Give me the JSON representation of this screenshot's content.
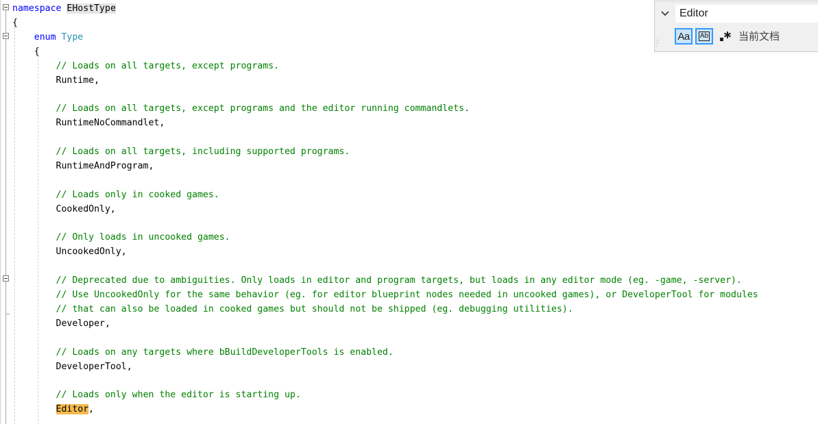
{
  "code": {
    "lines": [
      [
        {
          "t": "namespace",
          "c": "kw"
        },
        {
          "t": " ",
          "c": "id"
        },
        {
          "t": "EHostType",
          "c": "id",
          "h": "sel"
        }
      ],
      [
        {
          "t": "{",
          "c": "id"
        }
      ],
      [
        {
          "t": "    ",
          "c": "id"
        },
        {
          "t": "enum",
          "c": "kw"
        },
        {
          "t": " ",
          "c": "id"
        },
        {
          "t": "Type",
          "c": "type"
        }
      ],
      [
        {
          "t": "    {",
          "c": "id"
        }
      ],
      [
        {
          "t": "        ",
          "c": "id"
        },
        {
          "t": "// Loads on all targets, except programs.",
          "c": "cm"
        }
      ],
      [
        {
          "t": "        Runtime,",
          "c": "id"
        }
      ],
      [],
      [
        {
          "t": "        ",
          "c": "id"
        },
        {
          "t": "// Loads on all targets, except programs and the editor running commandlets.",
          "c": "cm"
        }
      ],
      [
        {
          "t": "        RuntimeNoCommandlet,",
          "c": "id"
        }
      ],
      [],
      [
        {
          "t": "        ",
          "c": "id"
        },
        {
          "t": "// Loads on all targets, including supported programs.",
          "c": "cm"
        }
      ],
      [
        {
          "t": "        RuntimeAndProgram,",
          "c": "id"
        }
      ],
      [],
      [
        {
          "t": "        ",
          "c": "id"
        },
        {
          "t": "// Loads only in cooked games.",
          "c": "cm"
        }
      ],
      [
        {
          "t": "        CookedOnly,",
          "c": "id"
        }
      ],
      [],
      [
        {
          "t": "        ",
          "c": "id"
        },
        {
          "t": "// Only loads in uncooked games.",
          "c": "cm"
        }
      ],
      [
        {
          "t": "        UncookedOnly,",
          "c": "id"
        }
      ],
      [],
      [
        {
          "t": "        ",
          "c": "id"
        },
        {
          "t": "// Deprecated due to ambiguities. Only loads in editor and program targets, but loads in any editor mode (eg. -game, -server).",
          "c": "cm"
        }
      ],
      [
        {
          "t": "        ",
          "c": "id"
        },
        {
          "t": "// Use UncookedOnly for the same behavior (eg. for editor blueprint nodes needed in uncooked games), or DeveloperTool for modules",
          "c": "cm"
        }
      ],
      [
        {
          "t": "        ",
          "c": "id"
        },
        {
          "t": "// that can also be loaded in cooked games but should not be shipped (eg. debugging utilities).",
          "c": "cm"
        }
      ],
      [
        {
          "t": "        Developer,",
          "c": "id"
        }
      ],
      [],
      [
        {
          "t": "        ",
          "c": "id"
        },
        {
          "t": "// Loads on any targets where bBuildDeveloperTools is enabled.",
          "c": "cm"
        }
      ],
      [
        {
          "t": "        DeveloperTool,",
          "c": "id"
        }
      ],
      [],
      [
        {
          "t": "        ",
          "c": "id"
        },
        {
          "t": "// Loads only when the editor is starting up.",
          "c": "cm"
        }
      ],
      [
        {
          "t": "        ",
          "c": "id"
        },
        {
          "t": "Editor",
          "c": "id",
          "h": "find"
        },
        {
          "t": ",",
          "c": "id"
        }
      ]
    ]
  },
  "find_widget": {
    "query": "Editor",
    "match_case_label": "Aa",
    "whole_word_label": "Ab",
    "scope_label": "当前文档",
    "match_case_active": true,
    "whole_word_active": true,
    "regex_icon": "regex-icon",
    "toggle_icon": "chevron-down-icon"
  },
  "colors": {
    "keyword": "#0000ff",
    "type": "#2b91af",
    "comment": "#008000",
    "find_highlight": "#f5b94e",
    "selection_highlight": "#e5e5e5",
    "toggle_border": "#3399ff"
  }
}
